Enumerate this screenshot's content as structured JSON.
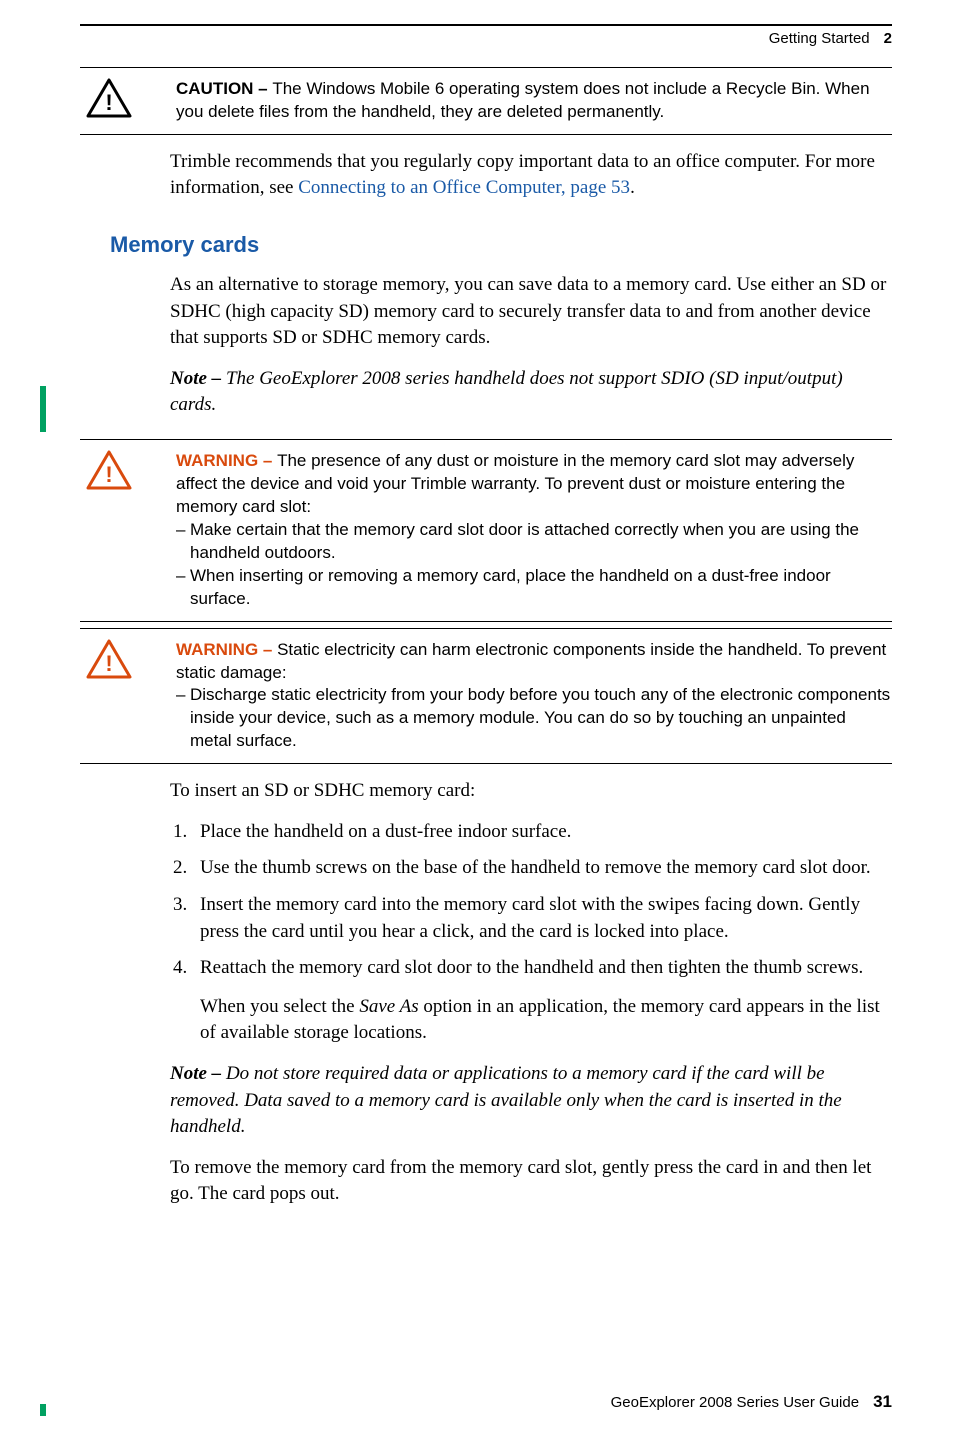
{
  "header": {
    "section": "Getting Started",
    "chapter_num": "2"
  },
  "caution1": {
    "label": "CAUTION – ",
    "text": "The Windows Mobile 6 operating system does not include a Recycle Bin. When you delete files from the handheld, they are deleted permanently."
  },
  "intro": {
    "p1_a": "Trimble recommends that you regularly copy important data to an office computer. For more information, see ",
    "p1_link": "Connecting to an Office Computer, page 53",
    "p1_b": "."
  },
  "section_title": "Memory cards",
  "mem": {
    "p1": "As an alternative to storage memory, you can save data to a memory card. Use either an SD or  SDHC (high capacity SD) memory card to securely transfer data to and from another device that supports SD or SDHC memory cards.",
    "note1_label": "Note – ",
    "note1_text": "The GeoExplorer 2008 series handheld does not support SDIO (SD input/output) cards."
  },
  "warning1": {
    "label": "WARNING – ",
    "lead": "The presence of any dust or moisture in the memory card slot may adversely affect the device and void your Trimble warranty. To prevent dust or moisture entering the memory card slot:",
    "d1": "Make certain that the memory card slot door is attached correctly when you are using the handheld outdoors.",
    "d2": "When inserting or removing a memory card, place the handheld on a dust-free indoor surface."
  },
  "warning2": {
    "label": "WARNING – ",
    "lead": "Static electricity can harm electronic components inside the handheld. To prevent static damage:",
    "d1": "Discharge static electricity from your body before you touch any of the electronic components inside your device, such as a memory module. You can do so by touching an unpainted metal surface."
  },
  "insert_lead": "To insert an SD or SDHC memory card:",
  "steps": {
    "s1": "Place the handheld on a dust-free indoor surface.",
    "s2": "Use the thumb screws on the base of the handheld to remove the memory card slot door.",
    "s3": "Insert the memory card into the memory card slot with the swipes facing down. Gently press the card until you hear a click, and the card is locked into place.",
    "s4": "Reattach the memory card slot door to the handheld and then tighten the thumb screws.",
    "s4_extra_a": "When you select the ",
    "s4_extra_i": "Save As",
    "s4_extra_b": " option in an application, the memory card appears in the list of available storage locations."
  },
  "note2_label": "Note – ",
  "note2_text": "Do not store required data or applications to a memory card if the card will be removed. Data saved to a memory card is available only when the card is inserted in the handheld.",
  "remove_text": "To remove the memory card from the memory card slot, gently press the card in and then let go. The card pops out.",
  "footer": {
    "guide": "GeoExplorer 2008 Series User Guide",
    "page": "31"
  }
}
